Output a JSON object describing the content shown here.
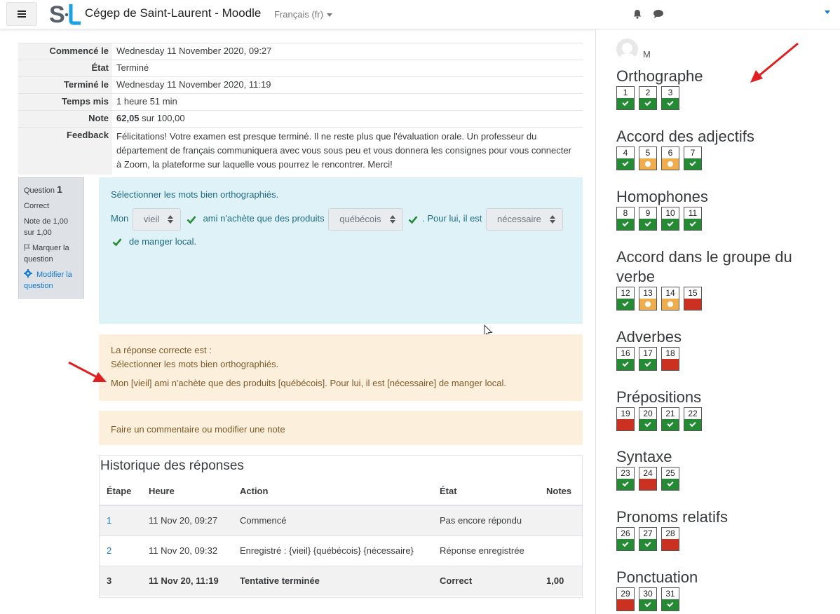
{
  "navbar": {
    "site_name": "Cégep de Saint-Laurent - Moodle",
    "language": "Français ‎(fr)‎",
    "logo_text": "S·L"
  },
  "summary": {
    "rows": [
      {
        "label": "Commencé le",
        "value": "Wednesday 11 November 2020, 09:27"
      },
      {
        "label": "État",
        "value": "Terminé"
      },
      {
        "label": "Terminé le",
        "value": "Wednesday 11 November 2020, 11:19"
      },
      {
        "label": "Temps mis",
        "value": "1 heure 51 min"
      },
      {
        "label": "Note",
        "value_bold": "62,05",
        "value_rest": " sur 100,00"
      },
      {
        "label": "Feedback",
        "value": "Félicitations! Votre examen est presque terminé. Il ne reste plus que l'évaluation orale. Un professeur du département de français communiquera avec vous sous peu et vous donnera les consignes pour vous connecter à Zoom, la plateforme sur laquelle vous pourrez le rencontrer. Merci!"
      }
    ]
  },
  "question_info": {
    "label": "Question",
    "number": "1",
    "state": "Correct",
    "grade": "Note de 1,00 sur 1,00",
    "flag": "Marquer la question",
    "edit": "Modifier la question"
  },
  "question": {
    "prompt": "Sélectionner les mots bien orthographiés.",
    "text1": "Mon",
    "select1": "vieil",
    "text2": "ami n'achète que des produits",
    "select2": "québécois",
    "text3": ". Pour lui, il est",
    "select3": "nécessaire",
    "text4": "de manger local."
  },
  "right_answer": {
    "heading": "La réponse correcte est :",
    "prompt": "Sélectionner les mots bien orthographiés.",
    "answer": "Mon [vieil] ami n'achète que des produits [québécois]. Pour lui, il est [nécessaire] de manger local."
  },
  "comment": {
    "link": "Faire un commentaire ou modifier une note"
  },
  "history": {
    "title": "Historique des réponses",
    "headers": [
      "Étape",
      "Heure",
      "Action",
      "État",
      "Notes"
    ],
    "rows": [
      {
        "step": "1",
        "time": "11 Nov 20, 09:27",
        "action": "Commencé",
        "state": "Pas encore répondu",
        "mark": ""
      },
      {
        "step": "2",
        "time": "11 Nov 20, 09:32",
        "action": "Enregistré : {vieil} {québécois} {nécessaire}",
        "state": "Réponse enregistrée",
        "mark": ""
      },
      {
        "step": "3",
        "time": "11 Nov 20, 11:19",
        "action": "Tentative terminée",
        "state": "Correct",
        "mark": "1,00"
      }
    ]
  },
  "navigation": {
    "user_initial": "M",
    "sections": [
      {
        "title": "Orthographe",
        "questions": [
          {
            "n": "1",
            "s": "correct"
          },
          {
            "n": "2",
            "s": "correct"
          },
          {
            "n": "3",
            "s": "correct"
          }
        ]
      },
      {
        "title": "Accord des adjectifs",
        "questions": [
          {
            "n": "4",
            "s": "correct"
          },
          {
            "n": "5",
            "s": "partial"
          },
          {
            "n": "6",
            "s": "partial"
          },
          {
            "n": "7",
            "s": "correct"
          }
        ]
      },
      {
        "title": "Homophones",
        "questions": [
          {
            "n": "8",
            "s": "correct"
          },
          {
            "n": "9",
            "s": "correct"
          },
          {
            "n": "10",
            "s": "correct"
          },
          {
            "n": "11",
            "s": "correct"
          }
        ]
      },
      {
        "title": "Accord dans le groupe du verbe",
        "questions": [
          {
            "n": "12",
            "s": "correct"
          },
          {
            "n": "13",
            "s": "partial"
          },
          {
            "n": "14",
            "s": "partial"
          },
          {
            "n": "15",
            "s": "incorrect"
          }
        ]
      },
      {
        "title": "Adverbes",
        "questions": [
          {
            "n": "16",
            "s": "correct"
          },
          {
            "n": "17",
            "s": "correct"
          },
          {
            "n": "18",
            "s": "incorrect"
          }
        ]
      },
      {
        "title": "Prépositions",
        "questions": [
          {
            "n": "19",
            "s": "incorrect"
          },
          {
            "n": "20",
            "s": "correct"
          },
          {
            "n": "21",
            "s": "correct"
          },
          {
            "n": "22",
            "s": "correct"
          }
        ]
      },
      {
        "title": "Syntaxe",
        "questions": [
          {
            "n": "23",
            "s": "correct"
          },
          {
            "n": "24",
            "s": "incorrect"
          },
          {
            "n": "25",
            "s": "correct"
          }
        ]
      },
      {
        "title": "Pronoms relatifs",
        "questions": [
          {
            "n": "26",
            "s": "correct"
          },
          {
            "n": "27",
            "s": "correct"
          },
          {
            "n": "28",
            "s": "incorrect"
          }
        ]
      },
      {
        "title": "Ponctuation",
        "questions": [
          {
            "n": "29",
            "s": "incorrect"
          },
          {
            "n": "30",
            "s": "correct"
          },
          {
            "n": "31",
            "s": "correct"
          }
        ]
      }
    ]
  },
  "colors": {
    "correct": "#258a34",
    "partial": "#f0ad4e",
    "incorrect": "#ca3120",
    "link": "#1177d1",
    "annotation_arrow": "#e02020"
  }
}
